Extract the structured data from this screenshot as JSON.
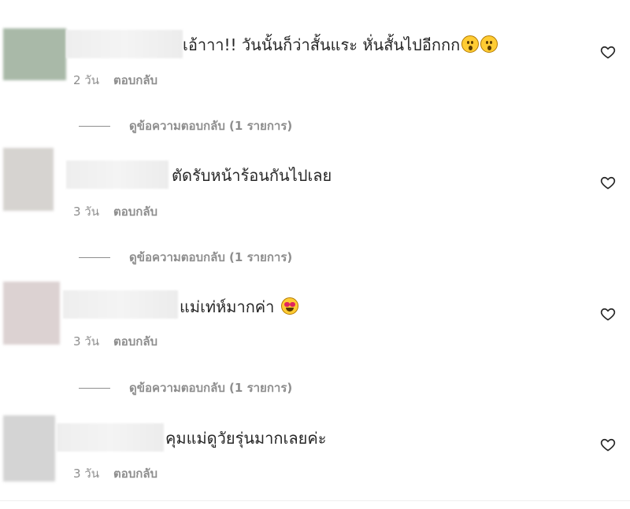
{
  "comments": [
    {
      "text": "เอ้าาา!! วันนั้นก็ว่าสั้นแระ หั่นสั้นไปอีกกก",
      "emojis": [
        "astonished-face",
        "astonished-face"
      ],
      "age": "2 วัน",
      "reply_label": "ตอบกลับ",
      "view_replies": "ดูข้อความตอบกลับ (1 รายการ)"
    },
    {
      "text": "ตัดรับหน้าร้อนกันไปเลย",
      "emojis": [],
      "age": "3 วัน",
      "reply_label": "ตอบกลับ",
      "view_replies": "ดูข้อความตอบกลับ (1 รายการ)"
    },
    {
      "text": "แม่เท่ห์มากค่า",
      "emojis": [
        "heart-eyes-face"
      ],
      "age": "3 วัน",
      "reply_label": "ตอบกลับ",
      "view_replies": "ดูข้อความตอบกลับ (1 รายการ)"
    },
    {
      "text": "คุมแม่ดูวัยรุ่นมากเลยค่ะ",
      "emojis": [],
      "age": "3 วัน",
      "reply_label": "ตอบกลับ"
    }
  ],
  "icons": {
    "like": "heart-outline-icon"
  },
  "colors": {
    "text": "#262626",
    "muted": "#8e8e8e",
    "divider": "#efefef"
  }
}
